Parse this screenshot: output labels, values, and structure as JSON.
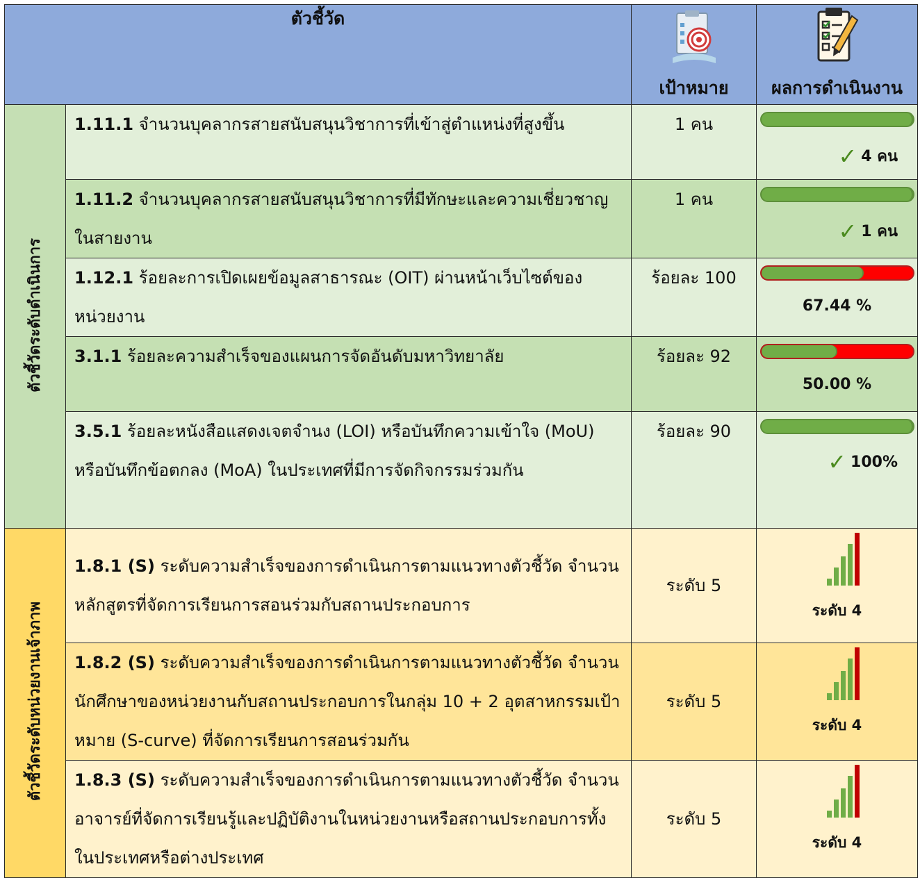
{
  "header": {
    "indicator": "ตัวชี้วัด",
    "target": "เป้าหมาย",
    "result": "ผลการดำเนินงาน",
    "target_icon": "target-clipboard-icon",
    "result_icon": "checklist-clipboard-icon"
  },
  "groups": [
    {
      "label": "ตัวชี้วัดระดับดำเนินการ",
      "color": "#c5dfb4"
    },
    {
      "label": "ตัวชี้วัดระดับหน่วยงานเจ้าภาพ",
      "color": "#ffd966"
    }
  ],
  "rows": [
    {
      "code": "1.11.1",
      "text": "จำนวนบุคลากรสายสนับสนุนวิชาการที่เข้าสู่ตำแหน่งที่สูงขึ้น",
      "target": "1 คน",
      "progress": 1.0,
      "result": "4 คน",
      "check": true
    },
    {
      "code": "1.11.2",
      "text": "จำนวนบุคลากรสายสนับสนุนวิชาการที่มีทักษะและความเชี่ยวชาญในสายงาน",
      "target": "1 คน",
      "progress": 1.0,
      "result": "1 คน",
      "check": true
    },
    {
      "code": "1.12.1",
      "text": "ร้อยละการเปิดเผยข้อมูลสาธารณะ (OIT) ผ่านหน้าเว็บไซต์ของหน่วยงาน",
      "target": "ร้อยละ 100",
      "progress": 0.6744,
      "result": "67.44 %",
      "check": false
    },
    {
      "code": "3.1.1",
      "text": "ร้อยละความสำเร็จของแผนการจัดอันดับมหาวิทยาลัย",
      "target": "ร้อยละ 92",
      "progress": 0.5,
      "result": "50.00 %",
      "check": false
    },
    {
      "code": "3.5.1",
      "text": "ร้อยละหนังสือแสดงเจตจำนง (LOI) หรือบันทึกความเข้าใจ (MoU) หรือบันทึกข้อตกลง (MoA) ในประเทศที่มีการจัดกิจกรรมร่วมกัน",
      "target": "ร้อยละ 90",
      "progress": 1.0,
      "result": "100%",
      "check": true
    },
    {
      "code": "1.8.1 (S)",
      "text": "ระดับความสำเร็จของการดำเนินการตามแนวทางตัวชี้วัด จำนวนหลักสูตรที่จัดการเรียนการสอนร่วมกับสถานประกอบการ",
      "target": "ระดับ 5",
      "level": 4,
      "max_level": 5,
      "result": "ระดับ 4"
    },
    {
      "code": "1.8.2 (S)",
      "text": "ระดับความสำเร็จของการดำเนินการตามแนวทางตัวชี้วัด จำนวนนักศึกษาของหน่วยงานกับสถานประกอบการในกลุ่ม 10 + 2 อุตสาหกรรมเป้าหมาย (S-curve) ที่จัดการเรียนการสอนร่วมกัน",
      "target": "ระดับ 5",
      "level": 4,
      "max_level": 5,
      "result": "ระดับ 4"
    },
    {
      "code": "1.8.3 (S)",
      "text": "ระดับความสำเร็จของการดำเนินการตามแนวทางตัวชี้วัด จำนวนอาจารย์ที่จัดการเรียนรู้และปฏิบัติงานในหน่วยงานหรือสถานประกอบการทั้งในประเทศหรือต่างประเทศ",
      "target": "ระดับ 5",
      "level": 4,
      "max_level": 5,
      "result": "ระดับ 4"
    }
  ],
  "colors": {
    "header_bg": "#8eaadb",
    "achieved": "#70ad47",
    "missing": "#ff0000",
    "level_on": "#70ad47",
    "level_current": "#c00000"
  }
}
